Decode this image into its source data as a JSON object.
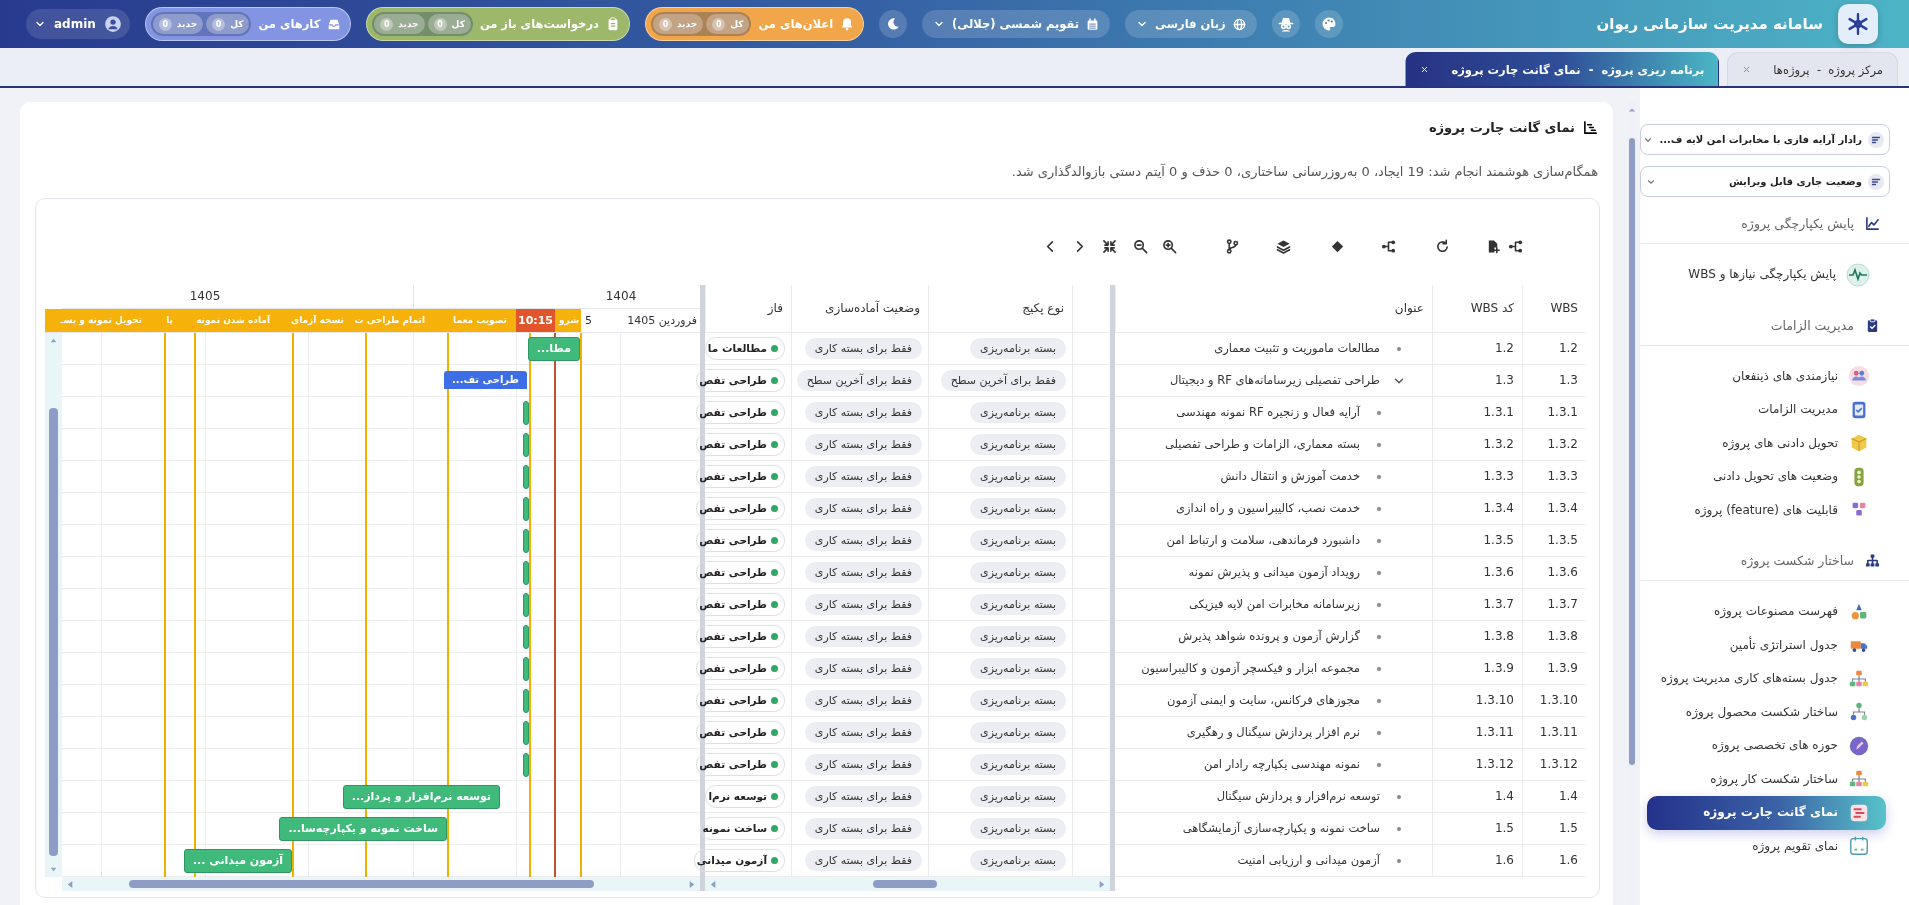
{
  "topbar": {
    "title": "سامانه مدیریت سازمانی ریوان",
    "language": "زبان فارسی",
    "calendar": "تقویم شمسی (جلالی)",
    "counters": [
      {
        "kind": "notifications",
        "label": "اعلان‌های من",
        "chips": [
          {
            "label": "کل",
            "count": "0"
          },
          {
            "label": "جدید",
            "count": "0"
          }
        ]
      },
      {
        "kind": "requests",
        "label": "درخواست‌های باز من",
        "chips": [
          {
            "label": "کل",
            "count": "0"
          },
          {
            "label": "جدید",
            "count": "0"
          }
        ]
      },
      {
        "kind": "tasks",
        "label": "کارهای من",
        "chips": [
          {
            "label": "کل",
            "count": "0"
          },
          {
            "label": "جدید",
            "count": "0"
          }
        ]
      }
    ],
    "user": "admin"
  },
  "tabs": [
    {
      "label": "مرکز پروژه  -  پروژه‌ها",
      "selected": false
    },
    {
      "label": "برنامه ریزی پروژه  -  نمای گانت چارت پروژه",
      "selected": true
    }
  ],
  "page": {
    "title": "نمای گانت چارت پروژه",
    "message": "همگام‌سازی هوشمند انجام شد: 19 ایجاد، 0 به‌روزرسانی ساختاری، 0 حذف و 0 آیتم دستی بازوالدگذاری شد."
  },
  "gantt": {
    "columns": {
      "wbs": "WBS",
      "code": "کد WBS",
      "title": "عنوان",
      "package": "نوع پکیج",
      "readiness": "وضعیت آماده‌سازی",
      "phase": "فاز"
    },
    "timeline": {
      "years": [
        "1404",
        "1405"
      ],
      "periods": [
        "1405 فروردین",
        "5"
      ],
      "today": "10:15",
      "milestones": [
        "شرو",
        "تصویب معما",
        "اتمام طراحی ت",
        "نسخه آزمای",
        "آماده شدن نمونه",
        "پا",
        "تحویل نمونه و بسـ"
      ]
    },
    "rows": [
      {
        "wbs": "1.2",
        "code": "1.2",
        "title": "مطالعات ماموریت و تثبیت معماری",
        "package": "بسته برنامه‌ریزی",
        "readiness": "فقط برای بسته کاری",
        "phase": "مطالعات ما",
        "bar": "مطا..."
      },
      {
        "wbs": "1.3",
        "code": "1.3",
        "title": "طراحی تفصیلی زیرسامانه‌های RF و دیجیتال",
        "package": "فقط برای آخرین سطح",
        "readiness": "فقط برای آخرین سطح",
        "phase": "طراحی تفص",
        "bar": "طراحی تف...",
        "expanded": true,
        "children": [
          {
            "wbs": "1.3.1",
            "code": "1.3.1",
            "title": "آرایه فعال و زنجیره RF نمونه مهندسی",
            "package": "بسته برنامه‌ریزی",
            "readiness": "فقط برای بسته کاری",
            "phase": "طراحی تفص"
          },
          {
            "wbs": "1.3.2",
            "code": "1.3.2",
            "title": "بسته معماری، الزامات و طراحی تفصیلی",
            "package": "بسته برنامه‌ریزی",
            "readiness": "فقط برای بسته کاری",
            "phase": "طراحی تفص"
          },
          {
            "wbs": "1.3.3",
            "code": "1.3.3",
            "title": "خدمت آموزش و انتقال دانش",
            "package": "بسته برنامه‌ریزی",
            "readiness": "فقط برای بسته کاری",
            "phase": "طراحی تفص"
          },
          {
            "wbs": "1.3.4",
            "code": "1.3.4",
            "title": "خدمت نصب، کالیبراسیون و راه اندازی",
            "package": "بسته برنامه‌ریزی",
            "readiness": "فقط برای بسته کاری",
            "phase": "طراحی تفص"
          },
          {
            "wbs": "1.3.5",
            "code": "1.3.5",
            "title": "داشبورد فرماندهی، سلامت و ارتباط امن",
            "package": "بسته برنامه‌ریزی",
            "readiness": "فقط برای بسته کاری",
            "phase": "طراحی تفص"
          },
          {
            "wbs": "1.3.6",
            "code": "1.3.6",
            "title": "رویداد آزمون میدانی و پذیرش نمونه",
            "package": "بسته برنامه‌ریزی",
            "readiness": "فقط برای بسته کاری",
            "phase": "طراحی تفص"
          },
          {
            "wbs": "1.3.7",
            "code": "1.3.7",
            "title": "زیرسامانه مخابرات امن لایه فیزیکی",
            "package": "بسته برنامه‌ریزی",
            "readiness": "فقط برای بسته کاری",
            "phase": "طراحی تفص"
          },
          {
            "wbs": "1.3.8",
            "code": "1.3.8",
            "title": "گزارش آزمون و پرونده شواهد پذیرش",
            "package": "بسته برنامه‌ریزی",
            "readiness": "فقط برای بسته کاری",
            "phase": "طراحی تفص"
          },
          {
            "wbs": "1.3.9",
            "code": "1.3.9",
            "title": "مجموعه ابزار و فیکسچر آزمون و کالیبراسیون",
            "package": "بسته برنامه‌ریزی",
            "readiness": "فقط برای بسته کاری",
            "phase": "طراحی تفص"
          },
          {
            "wbs": "1.3.10",
            "code": "1.3.10",
            "title": "مجوزهای فرکانس، سایت و ایمنی آزمون",
            "package": "بسته برنامه‌ریزی",
            "readiness": "فقط برای بسته کاری",
            "phase": "طراحی تفص"
          },
          {
            "wbs": "1.3.11",
            "code": "1.3.11",
            "title": "نرم افزار پردازش سیگنال و رهگیری",
            "package": "بسته برنامه‌ریزی",
            "readiness": "فقط برای بسته کاری",
            "phase": "طراحی تفص"
          },
          {
            "wbs": "1.3.12",
            "code": "1.3.12",
            "title": "نمونه مهندسی یکپارچه رادار امن",
            "package": "بسته برنامه‌ریزی",
            "readiness": "فقط برای بسته کاری",
            "phase": "طراحی تفص"
          }
        ]
      },
      {
        "wbs": "1.4",
        "code": "1.4",
        "title": "توسعه نرم‌افزار و پردازش سیگنال",
        "package": "بسته برنامه‌ریزی",
        "readiness": "فقط برای بسته کاری",
        "phase": "توسعه نرم‌ا",
        "bar": "توسعه نرم‌افزار و پرداز..."
      },
      {
        "wbs": "1.5",
        "code": "1.5",
        "title": "ساخت نمونه و یکپارچه‌سازی آزمایشگاهی",
        "package": "بسته برنامه‌ریزی",
        "readiness": "فقط برای بسته کاری",
        "phase": "ساخت نمونه",
        "bar": "ساخت نمونه و یکپارچه‌سا..."
      },
      {
        "wbs": "1.6",
        "code": "1.6",
        "title": "آزمون میدانی و ارزیابی امنیت",
        "package": "بسته برنامه‌ریزی",
        "readiness": "فقط برای بسته کاری",
        "phase": "آزمون میدانی",
        "bar": "آزمون میدانی ..."
      }
    ]
  },
  "sidebar": {
    "selectors": [
      {
        "value": "رادار آرایه فازی با مخابرات امن لایه ف..."
      },
      {
        "value": "وضعیت جاری قابل ویرایش"
      }
    ],
    "sections": [
      {
        "title": "پایش یکپارچگی پروژه",
        "items": [
          {
            "label": "پایش یکپارچگی نیازها و WBS",
            "selected": false
          }
        ]
      },
      {
        "title": "مدیریت الزامات",
        "items": [
          {
            "label": "نیازمندی های ذینفعان",
            "selected": false
          },
          {
            "label": "مدیریت الزامات",
            "selected": false
          },
          {
            "label": "تحویل دادنی های پروژه",
            "selected": false
          },
          {
            "label": "وضعیت های تحویل دادنی",
            "selected": false
          },
          {
            "label": "قابلیت های (feature) پروژه",
            "selected": false
          }
        ]
      },
      {
        "title": "ساختار شکست پروژه",
        "items": [
          {
            "label": "فهرست مصنوعات پروژه",
            "selected": false
          },
          {
            "label": "جدول استراتژی تأمین",
            "selected": false
          },
          {
            "label": "جدول بسته‌های کاری مدیریت پروژه",
            "selected": false
          },
          {
            "label": "ساختار شکست محصول پروژه",
            "selected": false
          },
          {
            "label": "حوزه های تخصصی پروژه",
            "selected": false
          },
          {
            "label": "ساختار شکست کار پروژه",
            "selected": false
          },
          {
            "label": "نمای گانت چارت پروژه",
            "selected": true
          },
          {
            "label": "نمای تقویم پروژه",
            "selected": false
          }
        ]
      }
    ]
  }
}
